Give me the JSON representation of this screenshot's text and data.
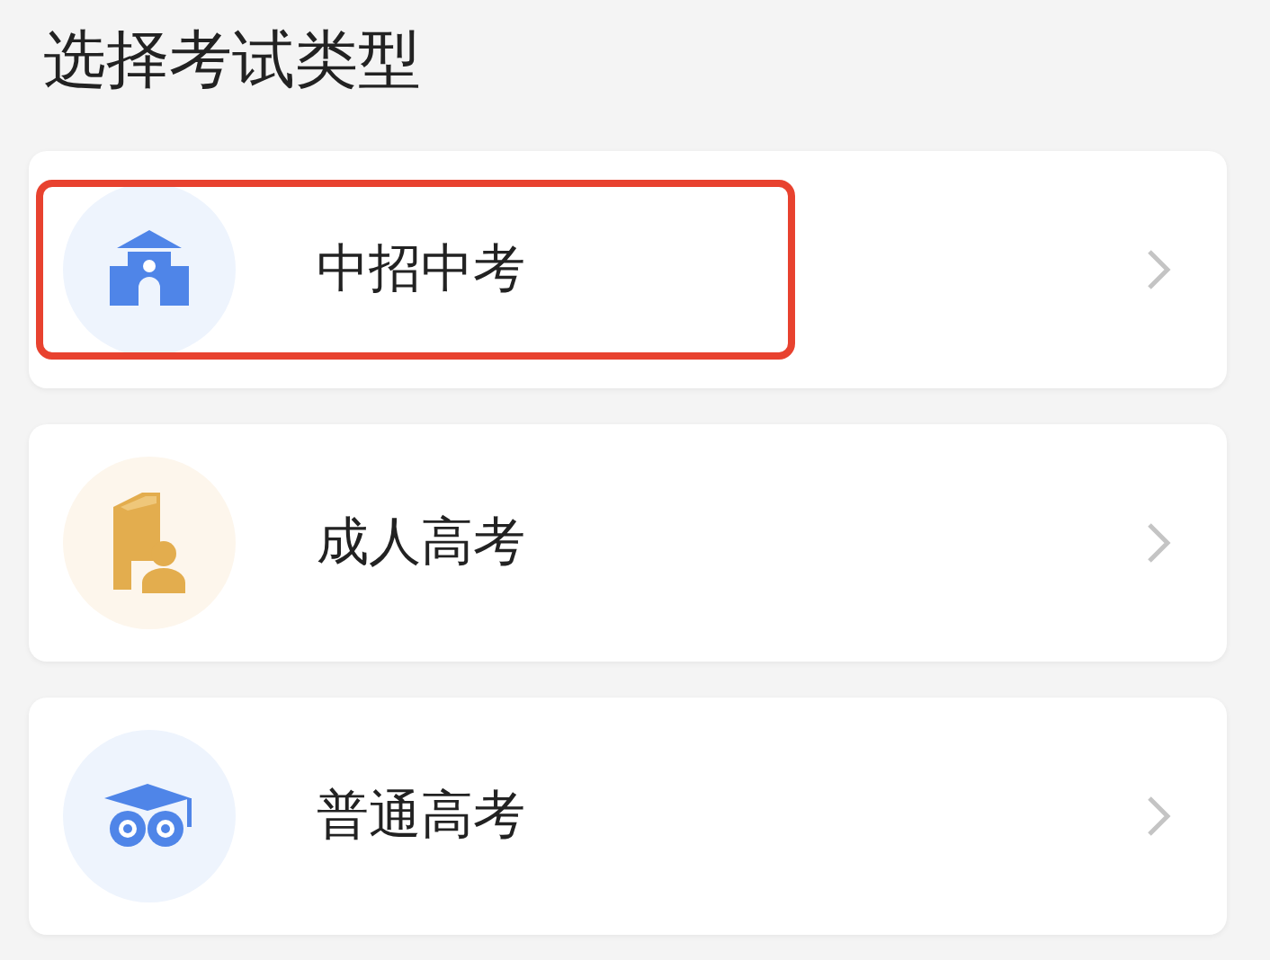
{
  "title": "选择考试类型",
  "options": [
    {
      "label": "中招中考",
      "kind": "school",
      "highlighted": true
    },
    {
      "label": "成人高考",
      "kind": "book",
      "highlighted": false
    },
    {
      "label": "普通高考",
      "kind": "owl",
      "highlighted": false
    }
  ]
}
